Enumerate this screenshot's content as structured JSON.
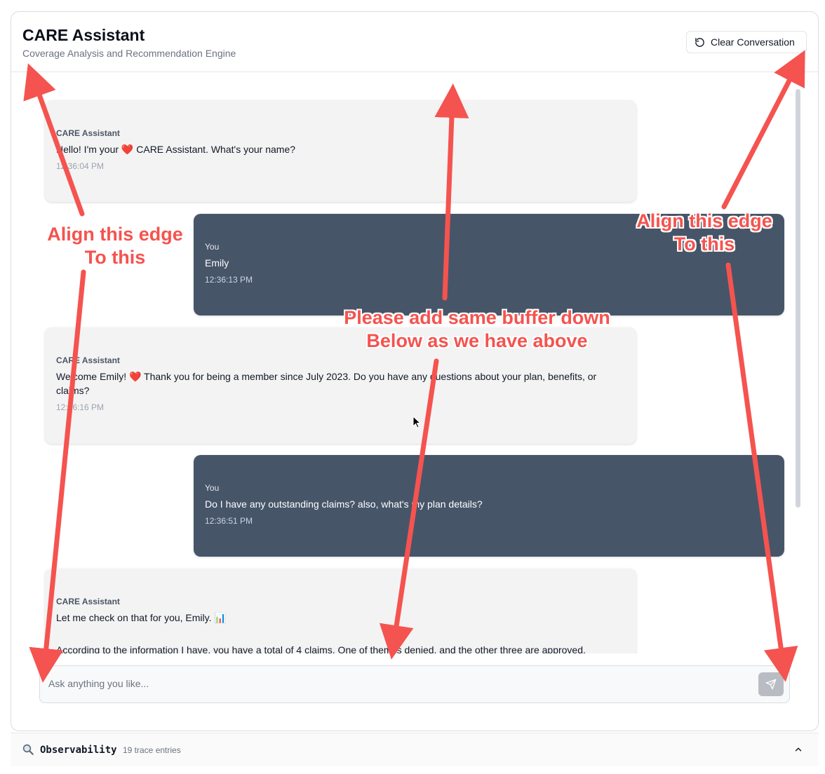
{
  "header": {
    "title": "CARE Assistant",
    "subtitle": "Coverage Analysis and Recommendation Engine",
    "clear_button": "Clear Conversation"
  },
  "messages": [
    {
      "sender": "CARE Assistant",
      "text_before": "Hello! I'm your ",
      "emoji": "❤️",
      "text_after": " CARE Assistant. What's your name?",
      "time": "12:36:04 PM"
    },
    {
      "sender": "You",
      "text": "Emily",
      "time": "12:36:13 PM"
    },
    {
      "sender": "CARE Assistant",
      "text_before": "Welcome Emily! ",
      "emoji": "❤️",
      "text_after": " Thank you for being a member since July 2023. Do you have any questions about your plan, benefits, or claims?",
      "time": "12:36:16 PM"
    },
    {
      "sender": "You",
      "text": "Do I have any outstanding claims?  also, what's my plan details?",
      "time": "12:36:51 PM"
    },
    {
      "sender": "CARE Assistant",
      "text_line1": "Let me check on that for you, Emily. ",
      "emoji": "📊",
      "text_line2": "According to the information I have, you have a total of 4 claims. One of them is denied, and the other three are approved."
    }
  ],
  "input": {
    "placeholder": "Ask anything you like..."
  },
  "observability": {
    "title": "Observability",
    "count": "19 trace entries"
  },
  "annotations": {
    "left": "Align this edge\nTo this",
    "right": "Align this edge\nTo this",
    "center": "Please add same buffer down\nBelow as we have above"
  },
  "colors": {
    "annotation": "#f5534f",
    "user_bubble": "#475569",
    "bot_bubble": "#f3f3f3"
  }
}
